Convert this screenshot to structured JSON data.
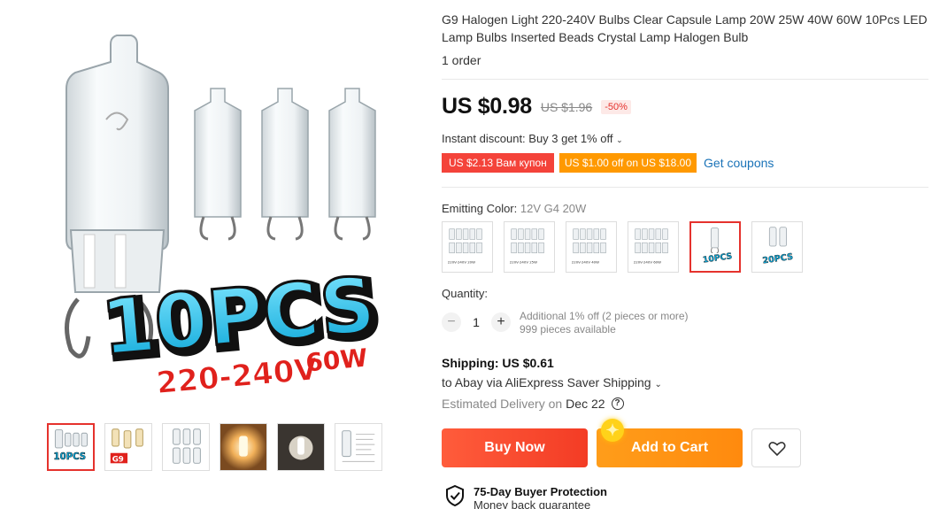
{
  "product": {
    "title": "G9 Halogen Light 220-240V Bulbs Clear Capsule Lamp 20W 25W 40W 60W 10Pcs LED Lamp Bulbs Inserted Beads Crystal Lamp Halogen Bulb",
    "orders": "1 order"
  },
  "gallery": {
    "main_image": {
      "headline": "10PCS",
      "subline_voltage": "220-240V",
      "subline_watt": "60W"
    },
    "thumbnails": [
      {
        "name": "thumb-10pcs",
        "text": "10PCS"
      },
      {
        "name": "thumb-g9",
        "text": "G9"
      },
      {
        "name": "thumb-bulbs-grid",
        "text": ""
      },
      {
        "name": "thumb-glowing-bulb",
        "text": ""
      },
      {
        "name": "thumb-lit-bulb",
        "text": ""
      },
      {
        "name": "thumb-spec-sheet",
        "text": ""
      }
    ]
  },
  "price": {
    "current": "US $0.98",
    "original": "US $1.96",
    "discount": "-50%"
  },
  "promo": {
    "instant_discount": "Instant discount: Buy 3 get 1% off",
    "coupon_1": "US $2.13 Вам купон",
    "coupon_2": "US $1.00 off on US $18.00",
    "get_coupons": "Get coupons"
  },
  "variants": {
    "label": "Emitting Color:",
    "selected": "12V G4 20W",
    "options": [
      {
        "caption": "220V-240V 20W"
      },
      {
        "caption": "220V-240V 25W"
      },
      {
        "caption": "220V-240V 40W"
      },
      {
        "caption": "220V-240V 60W"
      },
      {
        "caption": "10PCS"
      },
      {
        "caption": "20PCS"
      }
    ]
  },
  "quantity": {
    "label": "Quantity:",
    "value": "1",
    "minus": "−",
    "plus": "+",
    "note_1": "Additional 1% off (2 pieces or more)",
    "note_2": "999 pieces available"
  },
  "shipping": {
    "cost": "Shipping: US $0.61",
    "route": "to Abay via AliExpress Saver Shipping",
    "delivery_label": "Estimated Delivery on",
    "delivery_date": "Dec 22"
  },
  "actions": {
    "buy_now": "Buy Now",
    "add_to_cart": "Add to Cart"
  },
  "protection": {
    "title": "75-Day Buyer Protection",
    "subtitle": "Money back guarantee"
  },
  "colors": {
    "accent_red": "#f33c25",
    "accent_orange": "#ff8a0e",
    "link_blue": "#1a73b8"
  }
}
